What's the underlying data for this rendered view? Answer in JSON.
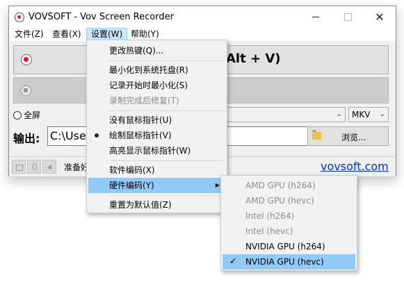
{
  "titlebar": {
    "title": "VOVSOFT - Vov Screen Recorder",
    "close_glyph": "✕"
  },
  "menubar": {
    "items": [
      {
        "label": "文件(Z)"
      },
      {
        "label": "查看(X)"
      },
      {
        "label": "设置(W)"
      },
      {
        "label": "帮助(Y)"
      }
    ]
  },
  "record_panel": {
    "hotkey_label": "Alt + V)"
  },
  "options": {
    "fullscreen_label": "全屏",
    "format_value": "MKV",
    "chevron": "⌄"
  },
  "output": {
    "label": "输出:",
    "path": "C:\\Users\\",
    "browse_label": "浏览..."
  },
  "statusbar": {
    "status": "准备好",
    "link": "vovsoft.com",
    "link_color": "#0033cc"
  },
  "settings_menu": {
    "items": [
      {
        "label": "更改热键(Q)...",
        "enabled": true
      },
      {
        "label": "最小化到系统托盘(R)",
        "enabled": true
      },
      {
        "label": "记录开始时最小化(S)",
        "enabled": true
      },
      {
        "label": "录制完成后修复(T)",
        "enabled": false
      },
      {
        "label": "没有鼠标指针(U)",
        "enabled": true
      },
      {
        "label": "绘制鼠标指针(V)",
        "enabled": true,
        "selected": true
      },
      {
        "label": "高亮显示鼠标指针(W)",
        "enabled": true
      },
      {
        "label": "软件编码(X)",
        "enabled": true
      },
      {
        "label": "硬件编码(Y)",
        "enabled": true,
        "highlighted": true,
        "submenu_arrow": "▶"
      },
      {
        "label": "重置为默认值(Z)",
        "enabled": true
      }
    ]
  },
  "hardware_menu": {
    "check_glyph": "✓",
    "items": [
      {
        "label": "AMD GPU (h264)",
        "enabled": false
      },
      {
        "label": "AMD GPU (hevc)",
        "enabled": false
      },
      {
        "label": "Intel (h264)",
        "enabled": false
      },
      {
        "label": "Intel (hevc)",
        "enabled": false
      },
      {
        "label": "NVIDIA GPU (h264)",
        "enabled": true
      },
      {
        "label": "NVIDIA GPU (hevc)",
        "enabled": true,
        "checked": true
      }
    ]
  },
  "colors": {
    "accent_red": "#d81b28",
    "menu_highlight": "#91c9f7"
  }
}
